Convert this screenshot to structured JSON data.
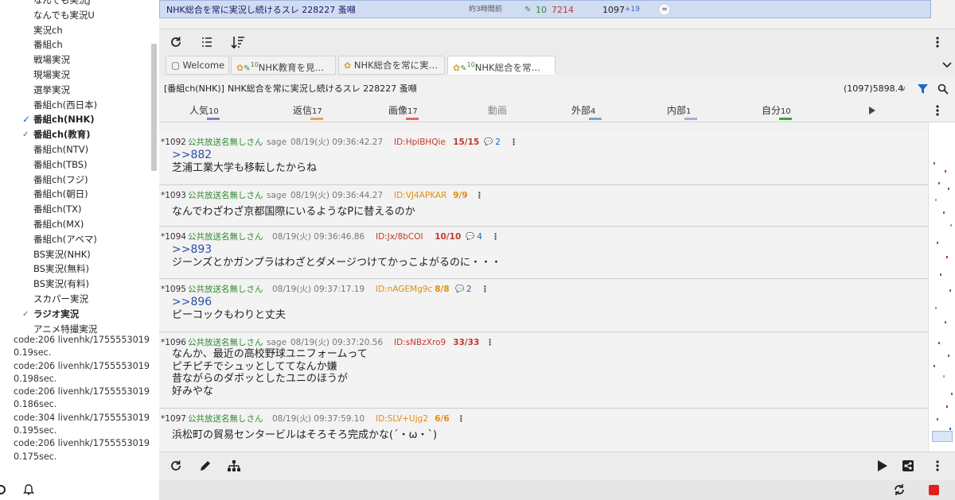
{
  "sidebar": {
    "items": [
      {
        "label": "なんでも実況J",
        "bold": false,
        "check": ""
      },
      {
        "label": "なんでも実況U",
        "bold": false,
        "check": ""
      },
      {
        "label": "実況ch",
        "bold": false,
        "check": ""
      },
      {
        "label": "番組ch",
        "bold": false,
        "check": ""
      },
      {
        "label": "戦場実況",
        "bold": false,
        "check": ""
      },
      {
        "label": "現場実況",
        "bold": false,
        "check": ""
      },
      {
        "label": "選挙実況",
        "bold": false,
        "check": ""
      },
      {
        "label": "番組ch(西日本)",
        "bold": false,
        "check": ""
      },
      {
        "label": "番組ch(NHK)",
        "bold": true,
        "check": "blue"
      },
      {
        "label": "番組ch(教育)",
        "bold": true,
        "check": "grey"
      },
      {
        "label": "番組ch(NTV)",
        "bold": false,
        "check": ""
      },
      {
        "label": "番組ch(TBS)",
        "bold": false,
        "check": ""
      },
      {
        "label": "番組ch(フジ)",
        "bold": false,
        "check": ""
      },
      {
        "label": "番組ch(朝日)",
        "bold": false,
        "check": ""
      },
      {
        "label": "番組ch(TX)",
        "bold": false,
        "check": ""
      },
      {
        "label": "番組ch(MX)",
        "bold": false,
        "check": ""
      },
      {
        "label": "番組ch(アベマ)",
        "bold": false,
        "check": ""
      },
      {
        "label": "BS実況(NHK)",
        "bold": false,
        "check": ""
      },
      {
        "label": "BS実況(無料)",
        "bold": false,
        "check": ""
      },
      {
        "label": "BS実況(有料)",
        "bold": false,
        "check": ""
      },
      {
        "label": "スカパー実況",
        "bold": false,
        "check": ""
      },
      {
        "label": "ラジオ実況",
        "bold": true,
        "check": "grey"
      },
      {
        "label": "アニメ特撮実況",
        "bold": false,
        "check": ""
      }
    ],
    "log": [
      "code:206 livenhk/1755553019",
      "0.19sec.",
      "code:206 livenhk/1755553019",
      "0.198sec.",
      "code:206 livenhk/1755553019",
      "0.186sec.",
      "code:304 livenhk/1755553019",
      "0.195sec.",
      "code:206 livenhk/1755553019",
      "0.175sec."
    ]
  },
  "thread_list": {
    "rows": [
      {
        "title": "NHK総合を常に実況し続けるスレ 228227 蚤噸",
        "age": "約3時間前",
        "pen_count": "10",
        "speed": "7214",
        "count": "1097",
        "new": "+19",
        "selected": true
      }
    ]
  },
  "tabs": [
    {
      "label": "Welcome",
      "icon": "folder-icon"
    },
    {
      "label": "NHK教育を見…",
      "sup": "10"
    },
    {
      "label": "NHK総合を常に実…"
    },
    {
      "label": "NHK総合を常…",
      "sup": "10",
      "active": true
    }
  ],
  "thread_header": {
    "board": "[番組ch(NHK)]",
    "title": "NHK総合を常に実況し続けるスレ 228227 蚤噸",
    "stats": "(1097)5898.4"
  },
  "filters": [
    {
      "label": "人気",
      "count": "10",
      "color": "#8e7cc3"
    },
    {
      "label": "返信",
      "count": "17",
      "color": "#e8a55a"
    },
    {
      "label": "画像",
      "count": "17",
      "color": "#e06666"
    },
    {
      "label": "動画",
      "count": "",
      "color": ""
    },
    {
      "label": "外部",
      "count": "4",
      "color": "#6fa8dc"
    },
    {
      "label": "内部",
      "count": "1",
      "color": "#b4a7d6"
    },
    {
      "label": "自分",
      "count": "10",
      "color": "#38a838"
    }
  ],
  "posts": [
    {
      "num": "*1092",
      "name": "公共放送名無しさん",
      "mail": "sage",
      "date": "08/19(火) 09:36:42.27",
      "id": "ID:HplBHQie",
      "count": "15/15",
      "replies": "2",
      "lines": [
        ">>882",
        "芝浦工業大学も移転したからね"
      ],
      "orange": false
    },
    {
      "num": "*1093",
      "name": "公共放送名無しさん",
      "mail": "sage",
      "date": "08/19(火) 09:36:44.27",
      "id": "ID:VJ4APKAR",
      "count": "9/9",
      "replies": "",
      "lines": [
        "なんでわざわざ京都国際にいるようなPに替えるのか"
      ],
      "orange": true
    },
    {
      "num": "*1094",
      "name": "公共放送名無しさん",
      "mail": "",
      "date": "08/19(火) 09:36:46.86",
      "id": "ID:Jx/8bCOI",
      "count": "10/10",
      "replies": "4",
      "lines": [
        ">>893",
        "ジーンズとかガンプラはわざとダメージつけてかっこよがるのに・・・"
      ],
      "orange": false
    },
    {
      "num": "*1095",
      "name": "公共放送名無しさん",
      "mail": "",
      "date": "08/19(火) 09:37:17.19",
      "id": "ID:nAGEMg9c",
      "count": "8/8",
      "replies": "2",
      "lines": [
        ">>896",
        "ピーコックもわりと丈夫"
      ],
      "orange": true
    },
    {
      "num": "*1096",
      "name": "公共放送名無しさん",
      "mail": "sage",
      "date": "08/19(火) 09:37:20.56",
      "id": "ID:sNBzXro9",
      "count": "33/33",
      "replies": "",
      "lines": [
        "なんか、最近の高校野球ユニフォームって",
        "ピチピチでシュッとしててなんか嫌",
        "昔ながらのダボッとしたユニのほうが",
        "好みやな"
      ],
      "orange": false
    },
    {
      "num": "*1097",
      "name": "公共放送名無しさん",
      "mail": "",
      "date": "08/19(火) 09:37:59.10",
      "id": "ID:SLV+Ujg2",
      "count": "6/6",
      "replies": "",
      "lines": [
        "浜松町の貿易センタービルはそろそろ完成かな(´・ω・`)"
      ],
      "orange": true
    }
  ],
  "icons": {
    "refresh": "refresh-icon",
    "list": "list-icon",
    "sort": "sort-icon",
    "more": "more-vert-icon",
    "filter": "filter-icon",
    "search": "search-icon",
    "edit": "pencil-icon",
    "tree": "tree-icon",
    "play": "play-icon",
    "share": "share-icon",
    "bell": "bell-icon",
    "stop": "stop-icon"
  },
  "colors": {
    "selected_row": "#cfdcf2",
    "filter_icon": "#1e66d0",
    "stop_button": "#e02020"
  }
}
